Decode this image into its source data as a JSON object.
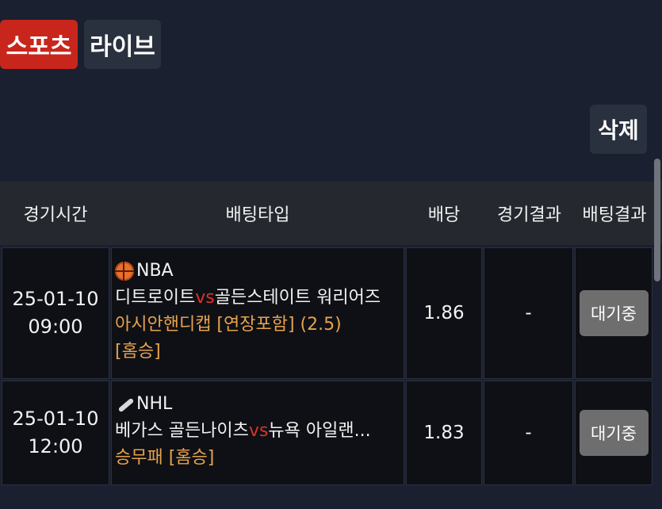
{
  "tabs": {
    "sports": "스포츠",
    "live": "라이브"
  },
  "delete_label": "삭제",
  "headers": {
    "time": "경기시간",
    "type": "배팅타입",
    "odds": "배당",
    "game_result": "경기결과",
    "bet_result": "배팅결과"
  },
  "rows": [
    {
      "date": "25-01-10",
      "time": "09:00",
      "league": "NBA",
      "league_icon": "basketball-icon",
      "home_team": "디트로이트",
      "vs": "vs",
      "away_team": "골든스테이트 워리어즈",
      "market": "아시안핸디캡 [연장포함] (2.5)",
      "pick": "[홈승]",
      "odds": "1.86",
      "game_result": "-",
      "status": "대기중"
    },
    {
      "date": "25-01-10",
      "time": "12:00",
      "league": "NHL",
      "league_icon": "hockey-stick-icon",
      "home_team": "베가스 골든나이츠",
      "vs": "vs",
      "away_team": "뉴욕 아일랜...",
      "market": "승무패 [홈승]",
      "odds": "1.83",
      "game_result": "-",
      "status": "대기중"
    }
  ],
  "colors": {
    "sports_tab": "#c8261c",
    "vs": "#d8342b",
    "market": "#e8a24c",
    "status_button": "#6e6e6e"
  }
}
